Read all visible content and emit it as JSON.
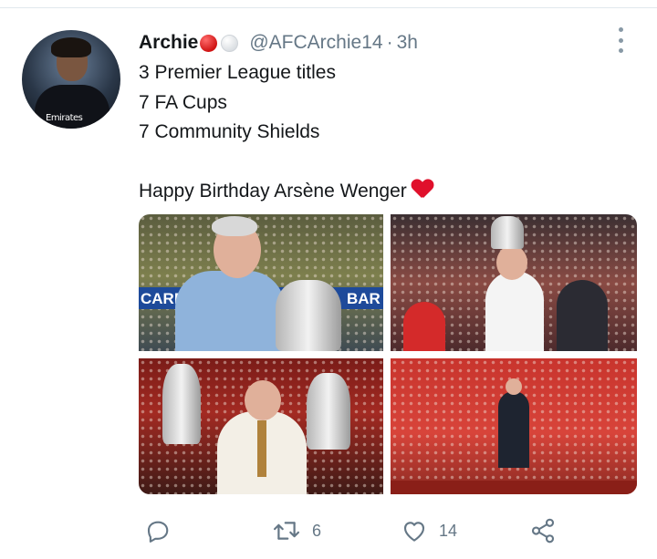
{
  "tweet": {
    "author": {
      "name": "Archie",
      "handle": "@AFCArchie14",
      "separator": "·",
      "time": "3h",
      "name_emojis": [
        "red-circle",
        "white-circle"
      ],
      "avatar_sponsor_text": "Emirates"
    },
    "text_lines": [
      "3 Premier League titles",
      "7 FA Cups",
      "7 Community Shields",
      "",
      "Happy Birthday Arsène Wenger"
    ],
    "text_end_emoji": "red-heart",
    "media": {
      "count": 4,
      "banner_text_left": "CARD",
      "banner_text_right": "BAR"
    },
    "actions": {
      "reply": {
        "icon": "reply-icon",
        "count": ""
      },
      "retweet": {
        "icon": "retweet-icon",
        "count": "6"
      },
      "like": {
        "icon": "heart-icon",
        "count": "14"
      },
      "share": {
        "icon": "share-icon",
        "count": ""
      }
    }
  },
  "colors": {
    "text": "#14171a",
    "secondary": "#657786",
    "divider": "#e1e8ed",
    "emoji_red": "#e0102b"
  }
}
